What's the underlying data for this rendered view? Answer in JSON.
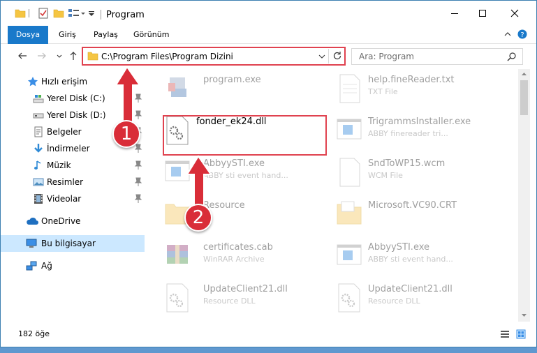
{
  "window": {
    "title": "Program",
    "accent_color": "#1979ca",
    "highlight_color": "#e0424f"
  },
  "ribbon": {
    "tabs": [
      {
        "label": "Dosya",
        "active": true
      },
      {
        "label": "Giriş"
      },
      {
        "label": "Paylaş"
      },
      {
        "label": "Görünüm"
      }
    ]
  },
  "address": {
    "path": "C:\\Program Files\\Program Dizini",
    "search_placeholder": "Ara: Program"
  },
  "sidebar": {
    "items": [
      {
        "label": "Hızlı erişim",
        "icon": "star-icon"
      },
      {
        "label": "Yerel Disk (C:)",
        "icon": "drive-icon",
        "pinned": true
      },
      {
        "label": "Yerel Disk (D:)",
        "icon": "drive-icon",
        "pinned": true
      },
      {
        "label": "Belgeler",
        "icon": "documents-icon",
        "pinned": true
      },
      {
        "label": "İndirmeler",
        "icon": "download-icon",
        "pinned": true
      },
      {
        "label": "Müzik",
        "icon": "music-icon",
        "pinned": true
      },
      {
        "label": "Resimler",
        "icon": "pictures-icon",
        "pinned": true
      },
      {
        "label": "Videolar",
        "icon": "video-icon",
        "pinned": true
      },
      {
        "label": "OneDrive",
        "icon": "cloud-icon"
      },
      {
        "label": "Bu bilgisayar",
        "icon": "computer-icon",
        "selected": true
      },
      {
        "label": "Ağ",
        "icon": "network-icon"
      }
    ]
  },
  "files": [
    {
      "name": "program.exe",
      "type": "",
      "icon": "exe-icon"
    },
    {
      "name": "help.fineReader.txt",
      "type": "TXT File",
      "icon": "text-file-icon"
    },
    {
      "name": "fonder_ek24.dll",
      "type": "",
      "icon": "dll-icon",
      "highlighted": true
    },
    {
      "name": "TrigrammsInstaller.exe",
      "type": "ABBY finereader tri...",
      "icon": "window-app-icon"
    },
    {
      "name": "AbbyySTI.exe",
      "type": "ABBY sti event hand...",
      "icon": "window-app-icon"
    },
    {
      "name": "SndToWP15.wcm",
      "type": "WCM File",
      "icon": "blank-file-icon"
    },
    {
      "name": "Resource",
      "type": "",
      "icon": "folder-icon"
    },
    {
      "name": "Microsoft.VC90.CRT",
      "type": "",
      "icon": "folder-icon"
    },
    {
      "name": "certificates.cab",
      "type": "WinRAR Archive",
      "icon": "archive-icon"
    },
    {
      "name": "AbbyySTI.exe",
      "type": "ABBY sti event hand...",
      "icon": "window-app-icon"
    },
    {
      "name": "UpdateClient21.dll",
      "type": "Resource DLL",
      "icon": "dll-icon"
    },
    {
      "name": "UpdateClient21.dll",
      "type": "Resource DLL",
      "icon": "dll-icon"
    }
  ],
  "status": {
    "item_count": "182 öğe"
  },
  "annotations": [
    {
      "number": "1"
    },
    {
      "number": "2"
    }
  ]
}
